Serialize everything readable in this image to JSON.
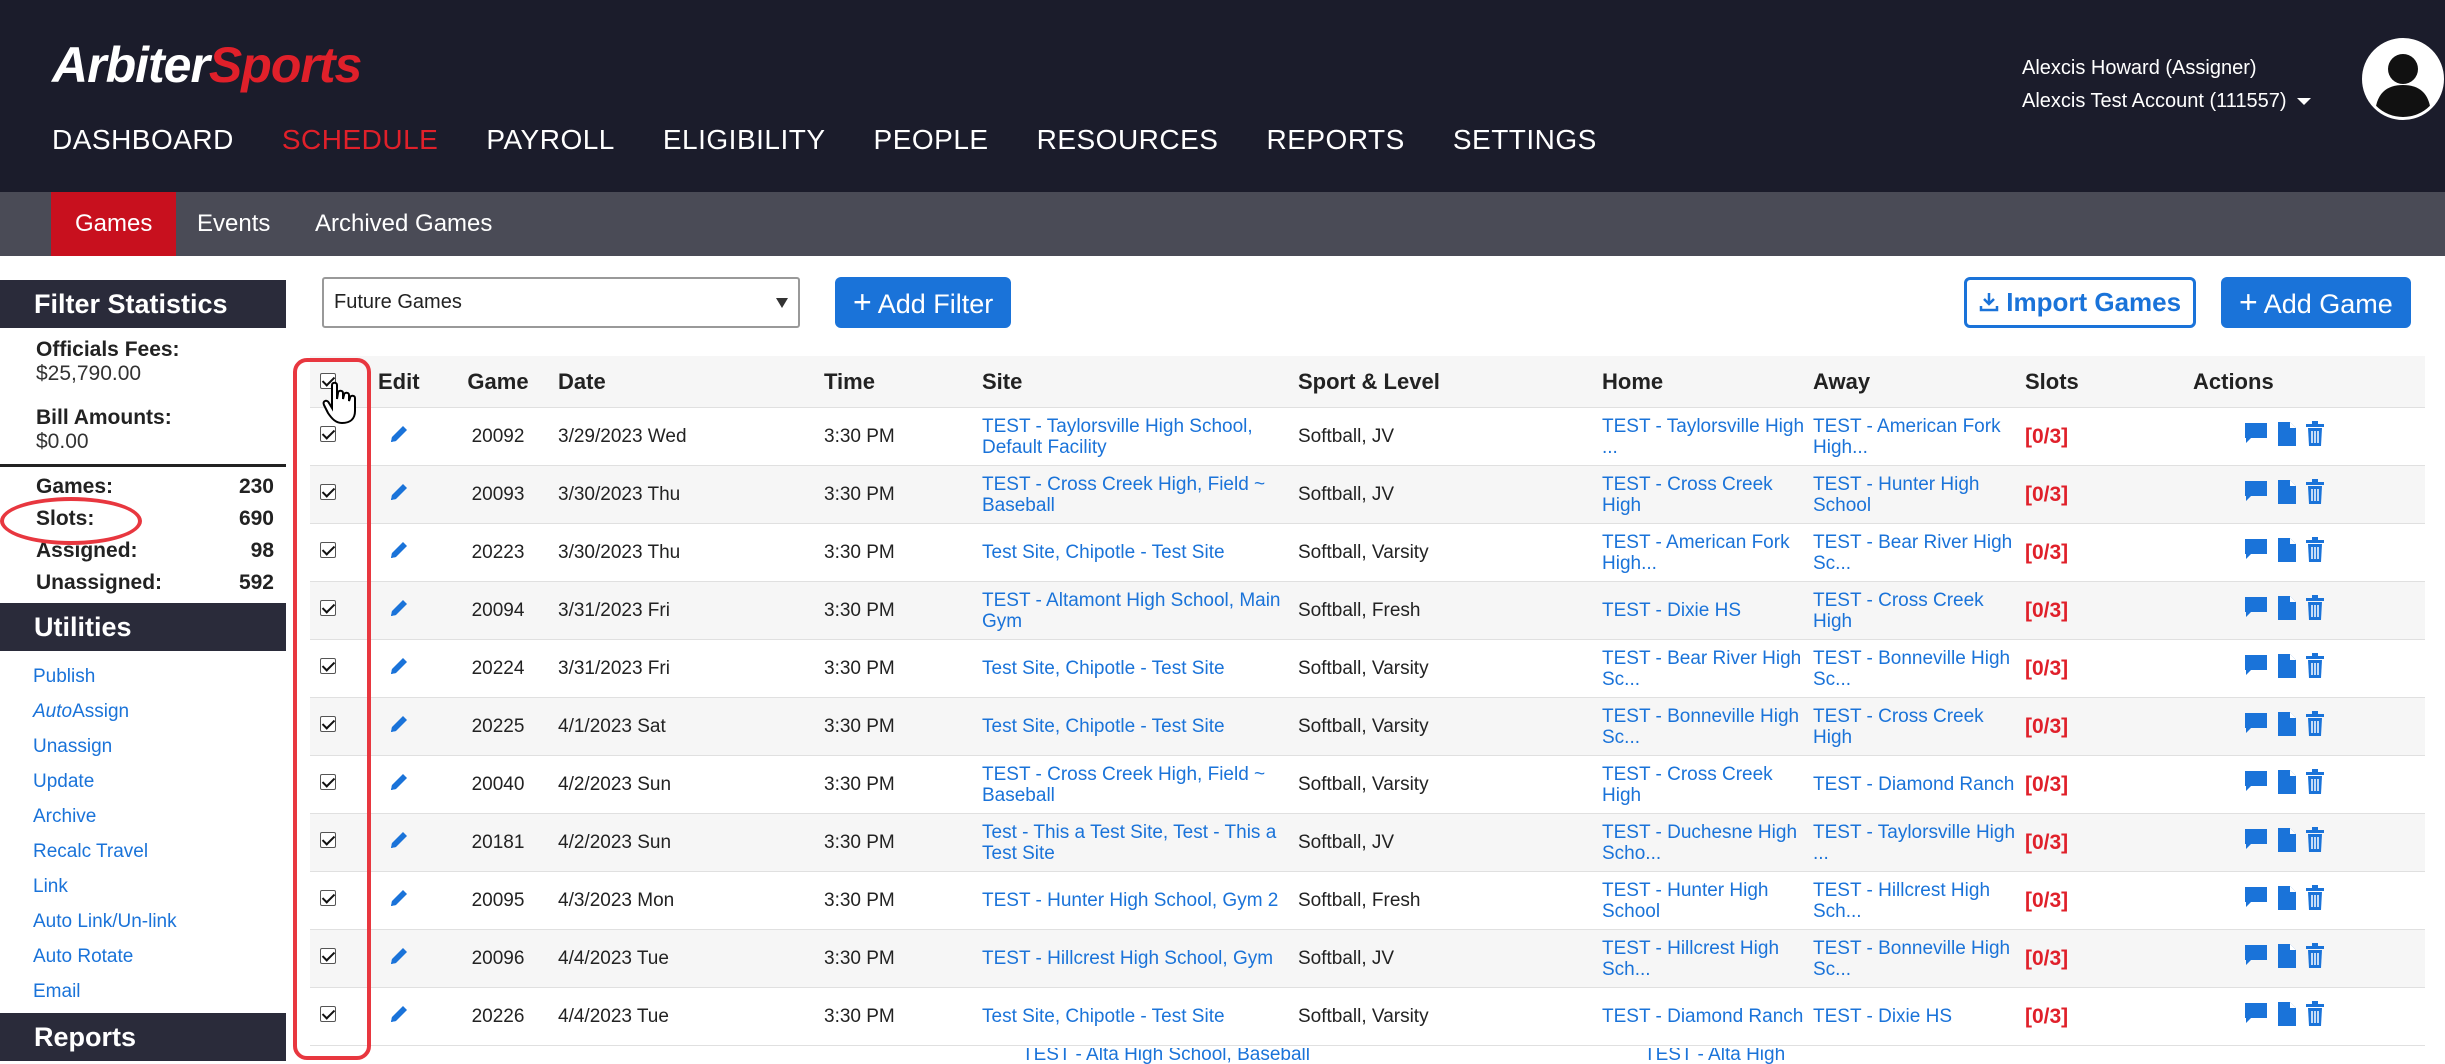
{
  "header": {
    "logo_main": "Arbiter",
    "logo_accent": "Sports",
    "user_name": "Alexcis Howard (Assigner)",
    "account": "Alexcis Test Account (111557)",
    "nav": [
      {
        "label": "DASHBOARD",
        "active": false
      },
      {
        "label": "SCHEDULE",
        "active": true
      },
      {
        "label": "PAYROLL",
        "active": false
      },
      {
        "label": "ELIGIBILITY",
        "active": false
      },
      {
        "label": "PEOPLE",
        "active": false
      },
      {
        "label": "RESOURCES",
        "active": false
      },
      {
        "label": "REPORTS",
        "active": false
      },
      {
        "label": "SETTINGS",
        "active": false
      }
    ]
  },
  "subnav": {
    "items": [
      {
        "label": "Games",
        "active": true
      },
      {
        "label": "Events",
        "active": false
      },
      {
        "label": "Archived Games",
        "active": false
      }
    ]
  },
  "sidebar": {
    "filter_title": "Filter Statistics",
    "officials_fees_label": "Officials Fees:",
    "officials_fees_value": "$25,790.00",
    "bill_amounts_label": "Bill Amounts:",
    "bill_amounts_value": "$0.00",
    "counts": [
      {
        "label": "Games:",
        "value": "230"
      },
      {
        "label": "Slots:",
        "value": "690"
      },
      {
        "label": "Assigned:",
        "value": "98"
      },
      {
        "label": "Unassigned:",
        "value": "592"
      }
    ],
    "utilities_title": "Utilities",
    "utilities": [
      {
        "label": "Publish"
      },
      {
        "label_italic": "Auto",
        "label": "Assign"
      },
      {
        "label": "Unassign"
      },
      {
        "label": "Update"
      },
      {
        "label": "Archive"
      },
      {
        "label": "Recalc Travel"
      },
      {
        "label": "Link"
      },
      {
        "label": "Auto Link/Un-link"
      },
      {
        "label": "Auto Rotate"
      },
      {
        "label": "Email"
      }
    ],
    "reports_title": "Reports"
  },
  "toolbar": {
    "filter_select": "Future Games",
    "add_filter": "Add Filter",
    "import_games": "Import Games",
    "add_game": "Add Game"
  },
  "table": {
    "columns": [
      "Edit",
      "Game",
      "Date",
      "Time",
      "Site",
      "Sport & Level",
      "Home",
      "Away",
      "Slots",
      "Actions"
    ],
    "rows": [
      {
        "game": "20092",
        "date": "3/29/2023 Wed",
        "time": "3:30 PM",
        "site": "TEST - Taylorsville High School, Default Facility",
        "sport": "Softball, JV",
        "home": "TEST - Taylorsville High ...",
        "away": "TEST - American Fork High...",
        "slots": "[0/3]"
      },
      {
        "game": "20093",
        "date": "3/30/2023 Thu",
        "time": "3:30 PM",
        "site": "TEST - Cross Creek High, Field ~ Baseball",
        "sport": "Softball, JV",
        "home": "TEST - Cross Creek High",
        "away": "TEST - Hunter High School",
        "slots": "[0/3]"
      },
      {
        "game": "20223",
        "date": "3/30/2023 Thu",
        "time": "3:30 PM",
        "site": "Test Site, Chipotle - Test Site",
        "sport": "Softball, Varsity",
        "home": "TEST - American Fork High...",
        "away": "TEST - Bear River High Sc...",
        "slots": "[0/3]"
      },
      {
        "game": "20094",
        "date": "3/31/2023 Fri",
        "time": "3:30 PM",
        "site": "TEST - Altamont High School, Main Gym",
        "sport": "Softball, Fresh",
        "home": "TEST - Dixie HS",
        "away": "TEST - Cross Creek High",
        "slots": "[0/3]"
      },
      {
        "game": "20224",
        "date": "3/31/2023 Fri",
        "time": "3:30 PM",
        "site": "Test Site, Chipotle - Test Site",
        "sport": "Softball, Varsity",
        "home": "TEST - Bear River High Sc...",
        "away": "TEST - Bonneville High Sc...",
        "slots": "[0/3]"
      },
      {
        "game": "20225",
        "date": "4/1/2023 Sat",
        "time": "3:30 PM",
        "site": "Test Site, Chipotle - Test Site",
        "sport": "Softball, Varsity",
        "home": "TEST - Bonneville High Sc...",
        "away": "TEST - Cross Creek High",
        "slots": "[0/3]"
      },
      {
        "game": "20040",
        "date": "4/2/2023 Sun",
        "time": "3:30 PM",
        "site": "TEST - Cross Creek High, Field ~ Baseball",
        "sport": "Softball, Varsity",
        "home": "TEST - Cross Creek High",
        "away": "TEST - Diamond Ranch",
        "slots": "[0/3]"
      },
      {
        "game": "20181",
        "date": "4/2/2023 Sun",
        "time": "3:30 PM",
        "site": "Test - This a Test Site, Test - This a Test Site",
        "sport": "Softball, JV",
        "home": "TEST - Duchesne High Scho...",
        "away": "TEST - Taylorsville High ...",
        "slots": "[0/3]"
      },
      {
        "game": "20095",
        "date": "4/3/2023 Mon",
        "time": "3:30 PM",
        "site": "TEST - Hunter High School, Gym 2",
        "sport": "Softball, Fresh",
        "home": "TEST - Hunter High School",
        "away": "TEST - Hillcrest High Sch...",
        "slots": "[0/3]"
      },
      {
        "game": "20096",
        "date": "4/4/2023 Tue",
        "time": "3:30 PM",
        "site": "TEST - Hillcrest High School, Gym",
        "sport": "Softball, JV",
        "home": "TEST - Hillcrest High Sch...",
        "away": "TEST - Bonneville High Sc...",
        "slots": "[0/3]"
      },
      {
        "game": "20226",
        "date": "4/4/2023 Tue",
        "time": "3:30 PM",
        "site": "Test Site, Chipotle - Test Site",
        "sport": "Softball, Varsity",
        "home": "TEST - Diamond Ranch",
        "away": "TEST - Dixie HS",
        "slots": "[0/3]"
      }
    ],
    "partial_row": {
      "site": "TEST - Alta High School, Baseball",
      "home": "TEST - Alta High"
    }
  },
  "colors": {
    "brand_dark": "#1b1c2b",
    "accent_red": "#e0202a",
    "link_blue": "#1a73d9",
    "annotation_red": "#e8373f"
  },
  "icons": [
    "user-avatar-icon",
    "pencil-icon",
    "comment-icon",
    "document-icon",
    "trash-icon",
    "plus-icon",
    "download-icon",
    "hand-cursor-icon"
  ]
}
